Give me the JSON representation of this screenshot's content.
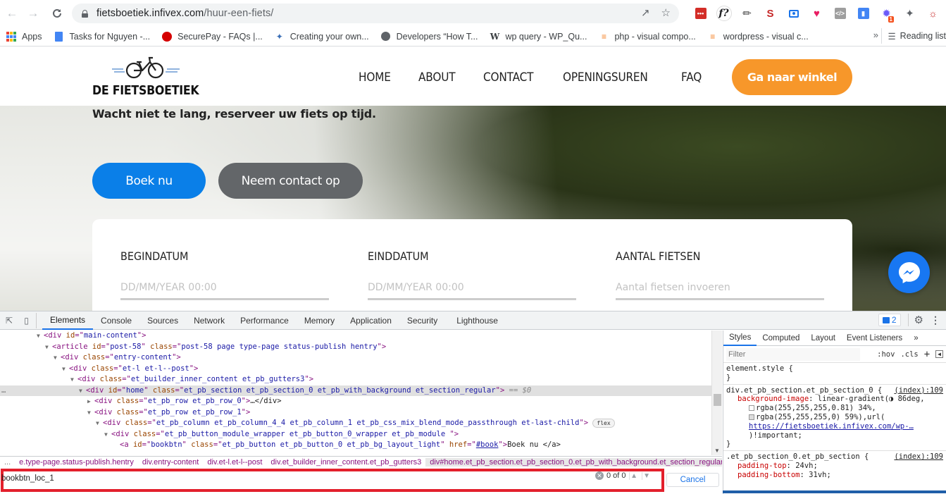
{
  "browser": {
    "url_host": "fietsboetiek.infivex.com",
    "url_path": "/huur-een-fiets/",
    "bookmarks": [
      {
        "label": "Apps",
        "icon": "apps-grid-icon"
      },
      {
        "label": "Tasks for Nguyen -...",
        "icon": "google-docs-icon"
      },
      {
        "label": "SecurePay - FAQs |...",
        "icon": "securepay-icon"
      },
      {
        "label": "Creating your own...",
        "icon": "bird-icon"
      },
      {
        "label": "Developers “How T...",
        "icon": "globe-icon"
      },
      {
        "label": "wp query - WP_Qu...",
        "icon": "wikipedia-w-icon"
      },
      {
        "label": "php - visual compo...",
        "icon": "stackoverflow-icon"
      },
      {
        "label": "wordpress - visual c...",
        "icon": "stackoverflow-icon"
      }
    ],
    "bookmarks_overflow": "»",
    "reading_list": "Reading list",
    "extension_badge": "1"
  },
  "site": {
    "logo_text": "DE FIETSBOETIEK",
    "nav": [
      "HOME",
      "ABOUT",
      "CONTACT",
      "OPENINGSUREN",
      "FAQ"
    ],
    "shop_button": "Ga naar winkel",
    "hero_text": "Wacht niet te lang, reserveer uw fiets op tijd.",
    "book_button": "Boek nu",
    "contact_button": "Neem contact op",
    "booking": {
      "fields": [
        {
          "label": "BEGINDATUM",
          "placeholder": "DD/MM/YEAR 00:00",
          "value": ""
        },
        {
          "label": "EINDDATUM",
          "placeholder": "DD/MM/YEAR 00:00",
          "value": ""
        },
        {
          "label": "AANTAL FIETSEN",
          "placeholder": "Aantal fietsen invoeren",
          "value": ""
        }
      ]
    },
    "colors": {
      "brand_orange": "#f7972a",
      "primary_blue": "#0a7fe8",
      "secondary_gray": "#636669",
      "messenger_blue": "#1877f2"
    }
  },
  "devtools": {
    "tabs": [
      "Elements",
      "Console",
      "Sources",
      "Network",
      "Performance",
      "Memory",
      "Application",
      "Security",
      "Lighthouse"
    ],
    "active_tab": "Elements",
    "issues_count": "2",
    "dom_lines": [
      {
        "indent": 0,
        "toggle": "▼",
        "tag": "div",
        "attrs": [
          [
            "id",
            "main-content"
          ]
        ],
        "close": ""
      },
      {
        "indent": 1,
        "toggle": "▼",
        "tag": "article",
        "attrs": [
          [
            "id",
            "post-58"
          ],
          [
            "class",
            "post-58 page type-page status-publish hentry"
          ]
        ],
        "close": ""
      },
      {
        "indent": 2,
        "toggle": "▼",
        "tag": "div",
        "attrs": [
          [
            "class",
            "entry-content"
          ]
        ],
        "close": ""
      },
      {
        "indent": 3,
        "toggle": "▼",
        "tag": "div",
        "attrs": [
          [
            "class",
            "et-l et-l--post"
          ]
        ],
        "close": ""
      },
      {
        "indent": 4,
        "toggle": "▼",
        "tag": "div",
        "attrs": [
          [
            "class",
            "et_builder_inner_content et_pb_gutters3"
          ]
        ],
        "close": ""
      },
      {
        "indent": 5,
        "toggle": "▼",
        "tag": "div",
        "attrs": [
          [
            "id",
            "home"
          ],
          [
            "class",
            "et_pb_section et_pb_section_0 et_pb_with_background et_section_regular"
          ]
        ],
        "close": "",
        "selected": true,
        "suffix": "== $0"
      },
      {
        "indent": 6,
        "toggle": "▶",
        "tag": "div",
        "attrs": [
          [
            "class",
            "et_pb_row et_pb_row_0"
          ]
        ],
        "close": "…</div>"
      },
      {
        "indent": 6,
        "toggle": "▼",
        "tag": "div",
        "attrs": [
          [
            "class",
            "et_pb_row et_pb_row_1"
          ]
        ],
        "close": ""
      },
      {
        "indent": 7,
        "toggle": "▼",
        "tag": "div",
        "attrs": [
          [
            "class",
            "et_pb_column et_pb_column_4_4 et_pb_column_1  et_pb_css_mix_blend_mode_passthrough et-last-child"
          ]
        ],
        "close": "",
        "badge": "flex"
      },
      {
        "indent": 8,
        "toggle": "▼",
        "tag": "div",
        "attrs": [
          [
            "class",
            "et_pb_button_module_wrapper et_pb_button_0_wrapper  et_pb_module "
          ]
        ],
        "close": ""
      },
      {
        "indent": 9,
        "toggle": "",
        "tag": "a",
        "attrs": [
          [
            "id",
            "bookbtn"
          ],
          [
            "class",
            "et_pb_button et_pb_button_0 et_pb_bg_layout_light"
          ],
          [
            "href",
            "#book"
          ]
        ],
        "close": "Boek nu </a>"
      }
    ],
    "breadcrumbs": [
      "...",
      "e.type-page.status-publish.hentry",
      "div.entry-content",
      "div.et-l.et-l--post",
      "div.et_builder_inner_content.et_pb_gutters3",
      "div#home.et_pb_section.et_pb_section_0.et_pb_with_background.et_section_regular",
      "..."
    ],
    "search": {
      "value": "bookbtn_loc_1",
      "match_count": "0 of 0",
      "cancel_label": "Cancel"
    },
    "styles": {
      "tabs": [
        "Styles",
        "Computed",
        "Layout",
        "Event Listeners",
        "»"
      ],
      "active_tab": "Styles",
      "filter_placeholder": "Filter",
      "hov": ":hov",
      "cls": ".cls",
      "rules": [
        {
          "selector": "element.style {",
          "source": "",
          "lines": [],
          "end": "}"
        },
        {
          "selector": "div.et_pb_section.et_pb_section_0 {",
          "source": "(index):109",
          "end": "}",
          "prop": "background-image",
          "value_lines": [
            "linear-gradient(◑ 86deg,",
            "rgba(255,255,255,0.81) 34%,",
            "rgba(255,255,255,0) 59%),url(",
            "https://fietsboetiek.infivex.com/wp-…",
            ")!important;"
          ]
        },
        {
          "selector": ".et_pb_section_0.et_pb_section {",
          "source": "(index):109",
          "end": "",
          "props": [
            [
              "padding-top",
              "24vh;"
            ],
            [
              "padding-bottom",
              "31vh;"
            ]
          ]
        }
      ]
    }
  }
}
